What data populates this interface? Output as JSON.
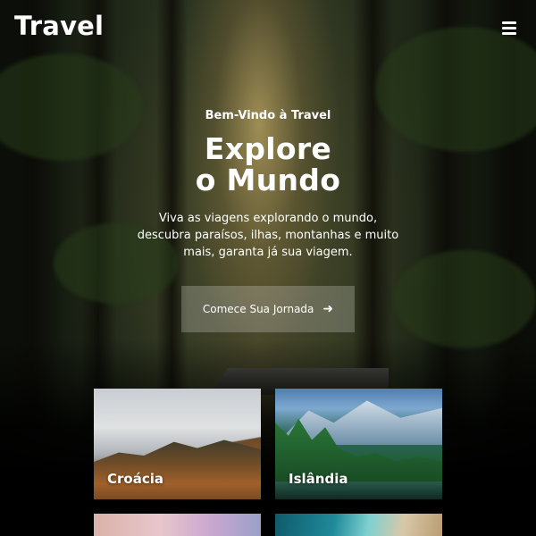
{
  "header": {
    "logo": "Travel",
    "menu_icon": "hamburger-menu-icon"
  },
  "hero": {
    "welcome": "Bem-Vindo à Travel",
    "headline_line1": "Explore",
    "headline_line2": "o Mundo",
    "description": "Viva as viagens explorando o mundo, descubra paraísos, ilhas, montanhas e muito mais, garanta já sua viagem.",
    "cta_label": "Comece Sua Jornada",
    "cta_icon": "arrow-right-icon"
  },
  "destinations": [
    {
      "name": "Croácia"
    },
    {
      "name": "Islândia"
    },
    {
      "name": ""
    },
    {
      "name": ""
    }
  ],
  "colors": {
    "text": "#ffffff",
    "cta_background": "rgba(255,255,255,0.22)"
  }
}
